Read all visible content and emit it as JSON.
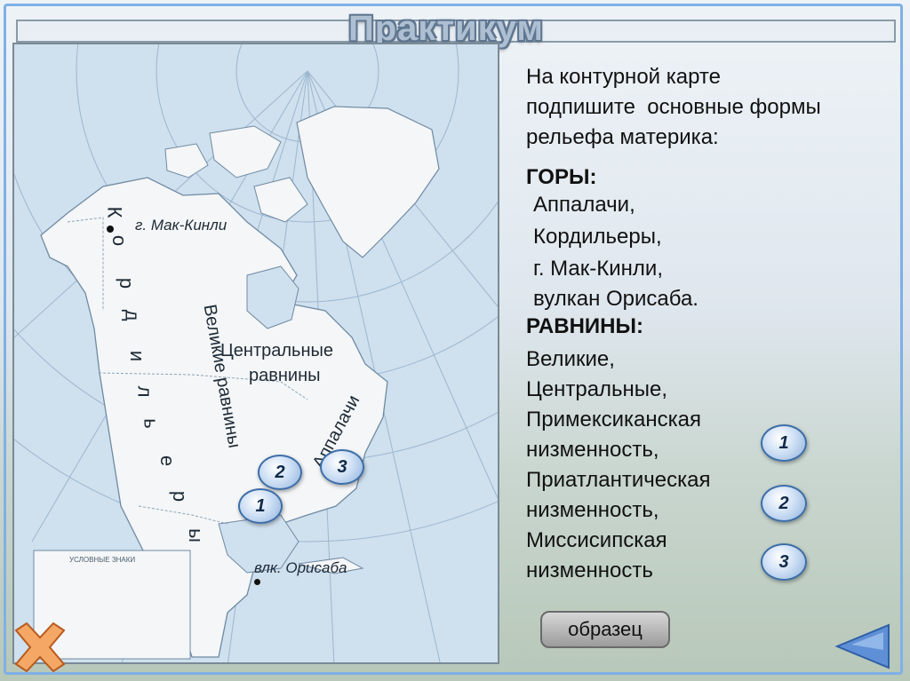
{
  "header": {
    "title": "Практикум"
  },
  "map": {
    "labels": {
      "mckinley": "г. Мак-Кинли",
      "cordillera_letters": [
        "К",
        "о",
        "р",
        "д",
        "и",
        "л",
        "ь",
        "е",
        "р",
        "ы"
      ],
      "great_plains": "Великие равнины",
      "central_plains_1": "Центральные",
      "central_plains_2": "равнины",
      "appalachians": "Аппалачи",
      "orizaba": "влк. Орисаба",
      "legend": "УСЛОВНЫЕ ЗНАКИ"
    },
    "markers": {
      "m1": "1",
      "m2": "2",
      "m3": "3"
    }
  },
  "task": {
    "intro_lines": [
      "На контурной карте",
      "подпишите  основные формы",
      "рельефа материка:"
    ],
    "mountains_heading": "ГОРЫ:",
    "mountains": [
      "Аппалачи,",
      "Кордильеры,",
      "г. Мак-Кинли,",
      "вулкан Орисаба."
    ],
    "plains_heading": "РАВНИНЫ:",
    "plains": [
      "Великие,",
      "Центральные,",
      "Примексиканская",
      "низменность,",
      "Приатлантическая",
      "низменность,",
      "Миссисипская",
      "низменность"
    ]
  },
  "buttons": {
    "b1": "1",
    "b2": "2",
    "b3": "3",
    "sample": "образец"
  },
  "colors": {
    "ocean": "#cfe0ee",
    "land": "#f4f6f7",
    "accent": "#3d6ea8",
    "close": "#f0a060",
    "arrow": "#5f8fd6"
  }
}
